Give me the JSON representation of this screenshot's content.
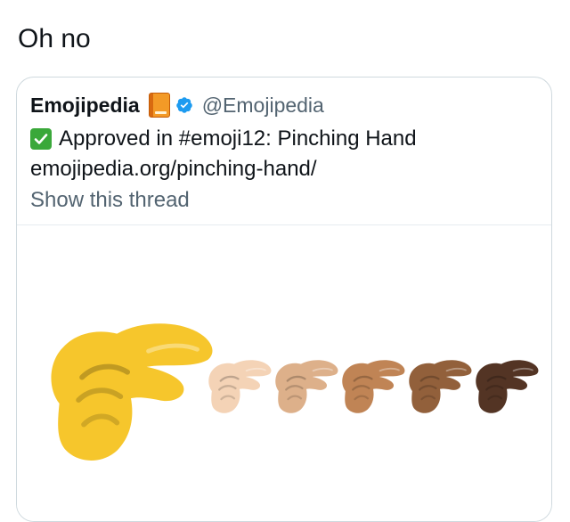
{
  "tweet": {
    "text": "Oh no"
  },
  "quoted_tweet": {
    "author_name": "Emojipedia",
    "handle": "@Emojipedia",
    "line1": "Approved in #emoji12: Pinching Hand",
    "line2": "emojipedia.org/pinching-hand/",
    "thread_link": "Show this thread",
    "icons": [
      "book-icon",
      "verified-icon",
      "check-icon"
    ]
  },
  "media": {
    "skin_tones": [
      "#f6c62c",
      "#f4d3b6",
      "#ddb08a",
      "#c08455",
      "#92603b",
      "#533424"
    ]
  },
  "colors": {
    "text": "#0f1419",
    "secondary": "#536471",
    "border": "#cfd9de",
    "verified": "#1d9bf0",
    "check": "#3aa83a"
  }
}
